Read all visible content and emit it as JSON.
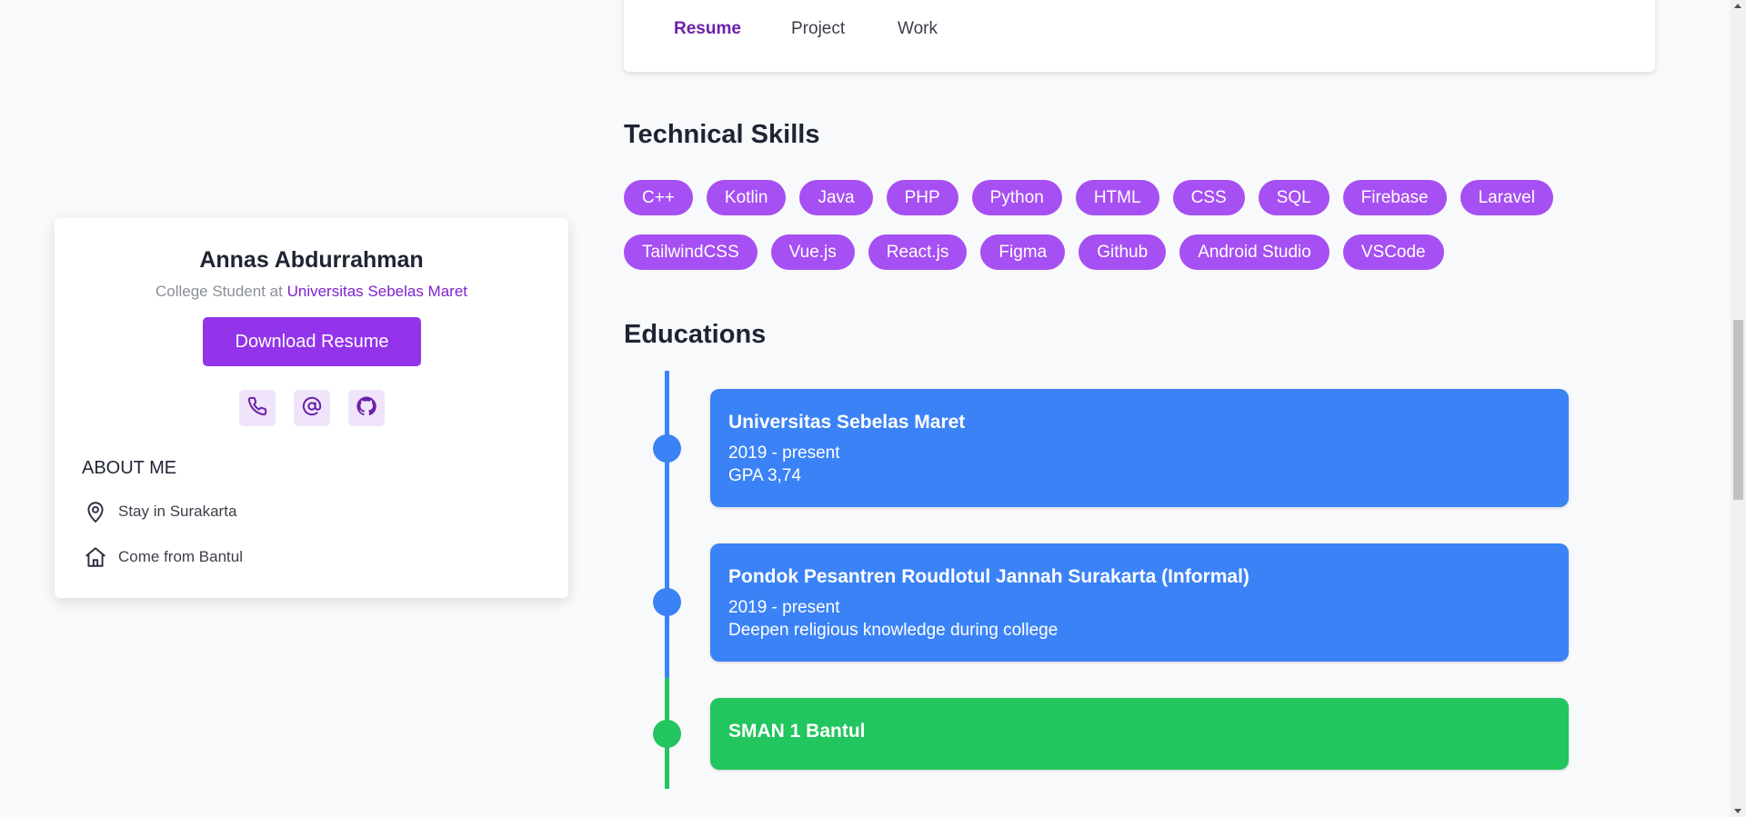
{
  "tabs": [
    {
      "label": "Resume",
      "active": true
    },
    {
      "label": "Project",
      "active": false
    },
    {
      "label": "Work",
      "active": false
    }
  ],
  "skills": {
    "title": "Technical Skills",
    "row1": [
      "C++",
      "Kotlin",
      "Java",
      "PHP",
      "Python",
      "HTML",
      "CSS",
      "SQL",
      "Firebase",
      "Laravel"
    ],
    "row2": [
      "TailwindCSS",
      "Vue.js",
      "React.js",
      "Figma",
      "Github",
      "Android Studio",
      "VSCode"
    ]
  },
  "educations": {
    "title": "Educations",
    "items": [
      {
        "title": "Universitas Sebelas Maret",
        "line1": "2019 - present",
        "line2": "GPA 3,74",
        "color": "#3b82f6"
      },
      {
        "title": "Pondok Pesantren Roudlotul Jannah Surakarta (Informal)",
        "line1": "2019 - present",
        "line2": "Deepen religious knowledge during college",
        "color": "#3b82f6"
      },
      {
        "title": "SMAN 1 Bantul",
        "color": "#22c55e"
      }
    ]
  },
  "profile": {
    "name": "Annas Abdurrahman",
    "subtitle_prefix": "College Student at",
    "university": "Universitas Sebelas Maret",
    "download_label": "Download Resume",
    "contact_icons": [
      "phone-icon",
      "at-sign-icon",
      "github-icon"
    ],
    "about_title": "ABOUT ME",
    "location": "Stay in Surakarta",
    "hometown": "Come from Bantul"
  },
  "colors": {
    "accent": "#9333ea",
    "chip": "#a64ff2",
    "timeline_blue": "#3b82f6",
    "timeline_green": "#22c55e"
  }
}
